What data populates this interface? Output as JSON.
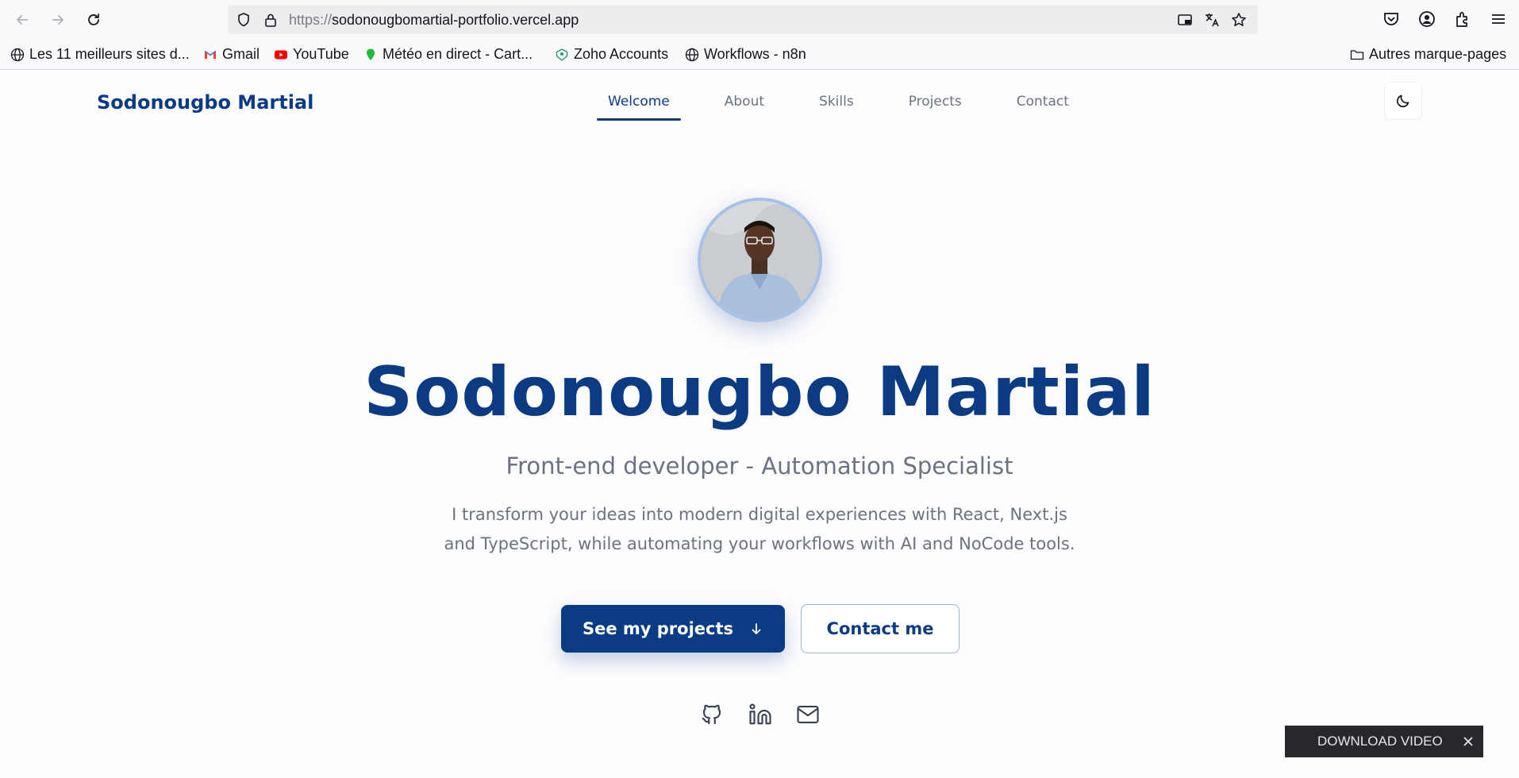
{
  "browser": {
    "url_protocol": "https://",
    "url_host": "sodonougbomartial-portfolio.vercel.app",
    "bookmarks": [
      {
        "label": "Les 11 meilleurs sites d...",
        "icon": "globe-icon"
      },
      {
        "label": "Gmail",
        "icon": "gmail-icon"
      },
      {
        "label": "YouTube",
        "icon": "youtube-icon"
      },
      {
        "label": "Météo en direct - Cart...",
        "icon": "weather-icon"
      },
      {
        "label": "Zoho Accounts",
        "icon": "zoho-icon"
      },
      {
        "label": "Workflows - n8n",
        "icon": "globe-icon"
      }
    ],
    "other_bookmarks": "Autres marque-pages"
  },
  "site": {
    "brand": "Sodonougbo Martial",
    "nav": [
      {
        "label": "Welcome",
        "active": true
      },
      {
        "label": "About",
        "active": false
      },
      {
        "label": "Skills",
        "active": false
      },
      {
        "label": "Projects",
        "active": false
      },
      {
        "label": "Contact",
        "active": false
      }
    ],
    "theme_toggle_icon": "moon-icon"
  },
  "hero": {
    "name": "Sodonougbo Martial",
    "subtitle": "Front-end developer - Automation Specialist",
    "description": "I transform your ideas into modern digital experiences with React, Next.js and TypeScript, while automating your workflows with AI and NoCode tools.",
    "primary_button": "See my projects",
    "secondary_button": "Contact me",
    "socials": [
      "github-icon",
      "linkedin-icon",
      "mail-icon"
    ]
  },
  "download_bar": {
    "label": "DOWNLOAD VIDEO"
  },
  "colors": {
    "brand_blue": "#0b3b82",
    "muted_text": "#6b7280"
  }
}
